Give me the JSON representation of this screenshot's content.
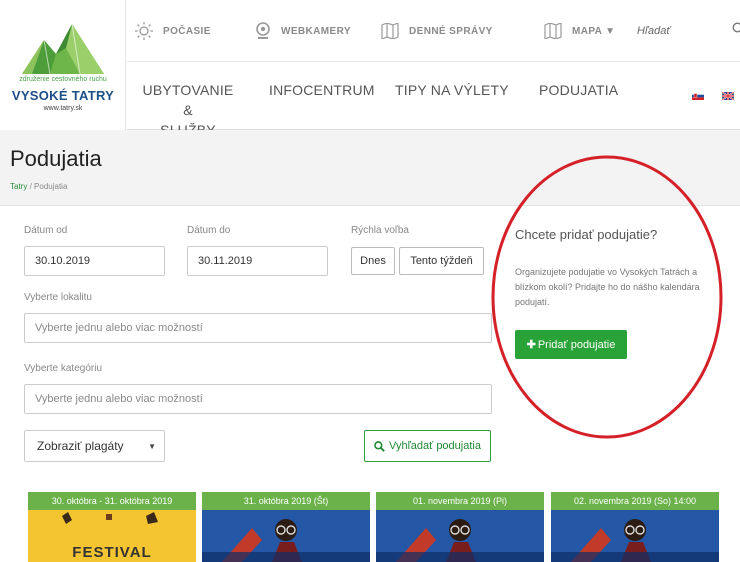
{
  "logo": {
    "tagline": "združenie cestovného ruchu",
    "brand": "VYSOKÉ TATRY",
    "url": "www.tatry.sk"
  },
  "topbar": {
    "items": [
      {
        "label": "POČASIE",
        "icon": "sun-icon"
      },
      {
        "label": "WEBKAMERY",
        "icon": "webcam-icon"
      },
      {
        "label": "DENNÉ SPRÁVY",
        "icon": "news-icon"
      },
      {
        "label": "MAPA ▼",
        "icon": "map-icon"
      }
    ],
    "search_placeholder": "Hľadať"
  },
  "mainnav": {
    "items": [
      {
        "label": "UBYTOVANIE &\nSLUŽBY"
      },
      {
        "label": "INFOCENTRUM"
      },
      {
        "label": "TIPY NA VÝLETY"
      },
      {
        "label": "PODUJATIA"
      }
    ]
  },
  "page": {
    "title": "Podujatia",
    "breadcrumb": {
      "home": "Tatry",
      "sep": "/",
      "current": "Podujatia"
    }
  },
  "filter": {
    "date_from_label": "Dátum od",
    "date_from_value": "30.10.2019",
    "date_to_label": "Dátum do",
    "date_to_value": "30.11.2019",
    "quick_label": "Rýchla voľba",
    "today_btn": "Dnes",
    "week_btn": "Tento týždeň",
    "locality_label": "Vyberte lokalitu",
    "locality_placeholder": "Vyberte jednu alebo viac možností",
    "category_label": "Vyberte kategóriu",
    "category_placeholder": "Vyberte jednu alebo viac možností",
    "display_select": "Zobraziť plagáty",
    "search_btn": "Vyhľadať podujatia"
  },
  "add_event": {
    "title": "Chcete pridať podujatie?",
    "text": "Organizujete podujatie vo Vysokých Tatrách a blízkom okolí? Pridajte ho do nášho kalendára podujatí.",
    "button": "Pridať podujatie"
  },
  "events": [
    {
      "date": "30. októbra - 31. októbra 2019",
      "poster": "FESTIVAL"
    },
    {
      "date": "31. októbra 2019 (Št)"
    },
    {
      "date": "01. novembra 2019 (Pi)"
    },
    {
      "date": "02. novembra 2019 (So) 14:00"
    }
  ],
  "colors": {
    "accent_green": "#29a337",
    "brand_blue": "#1d4f87",
    "highlight_red": "#d42027"
  }
}
